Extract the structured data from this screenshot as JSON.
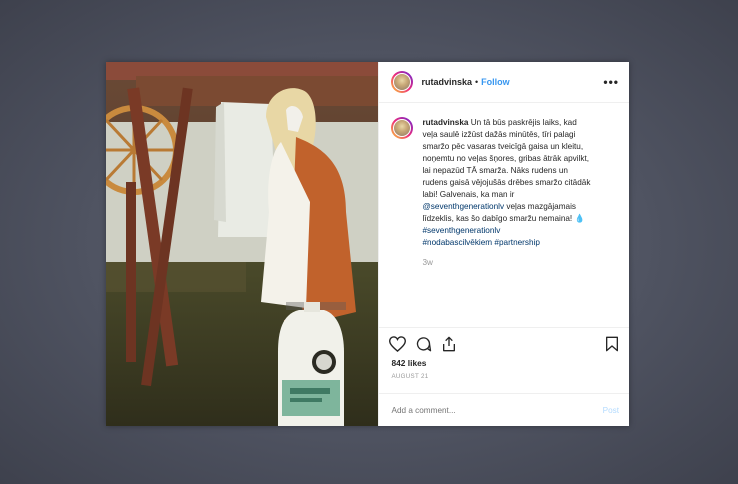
{
  "post": {
    "username": "rutadvinska",
    "separator": "•",
    "follow_label": "Follow",
    "more_label": "•••",
    "caption_text": "Un tā būs paskrējis laiks, kad veļa saulē izžūst dažās minūtēs, tīri palagi smaržo pēc vasaras tveicīgā gaisa un kleitu, noņemtu no veļas šņores, gribas ātrāk apvilkt, lai nepazūd TĀ smarža. Nāks rudens un rudens gaisā vējojušās drēbes smaržo citādāk labi! Galvenais, ka man ir",
    "mention": "@seventhgenerationlv",
    "caption_text_2": "veļas mazgājamais līdzeklis, kas šo dabīgo smaržu nemaina! 💧",
    "hashtags": [
      "#seventhgenerationlv",
      "#nodabascilvēkiem",
      "#partnership"
    ],
    "time_ago": "3w",
    "likes": "842 likes",
    "date": "AUGUST 21",
    "comment_placeholder": "Add a comment...",
    "post_button": "Post"
  },
  "icons": {
    "like": "heart-icon",
    "comment": "comment-icon",
    "share": "share-icon",
    "save": "bookmark-icon"
  }
}
